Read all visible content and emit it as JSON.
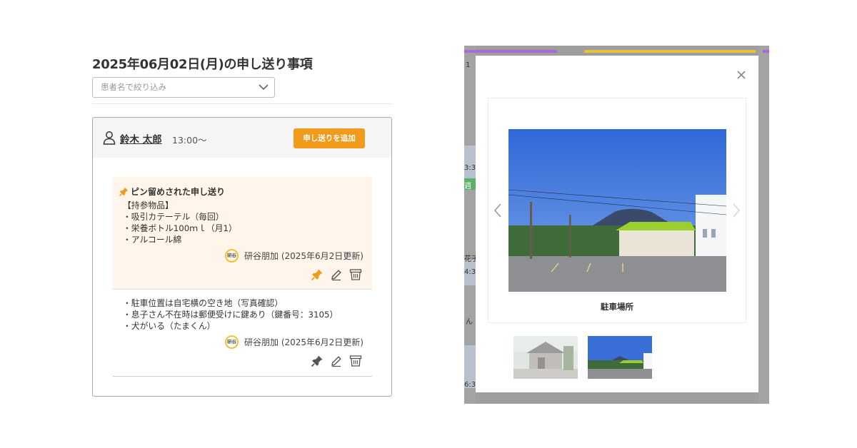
{
  "page_title": "2025年06月02日(月)の申し送り事項",
  "filter": {
    "placeholder": "患者名で絞り込み"
  },
  "patient": {
    "name": "鈴木 太郎",
    "time": "13:00〜"
  },
  "add_button": "申し送りを追加",
  "pinned_note": {
    "heading": "ピン留めされた申し送り",
    "lines": [
      "【持参物品】",
      "・吸引カテーテル（毎回）",
      "・栄養ボトル100ｍｌ（月1）",
      "・アルコール綿"
    ],
    "author_badge": "研谷",
    "author": "研谷朋加 (2025年6月2日更新)"
  },
  "note2": {
    "lines": [
      "・駐車位置は自宅横の空き地（写真確認）",
      "・息子さん不在時は郵便受けに鍵あり（鍵番号：3105）",
      "・犬がいる（たまくん）"
    ],
    "author_badge": "研谷",
    "author": "研谷朋加 (2025年6月2日更新)"
  },
  "modal": {
    "caption": "駐車場所"
  },
  "bg_fragments": [
    "1",
    "3:3",
    "週",
    "花子",
    "4:3",
    "ん",
    "6:3"
  ],
  "colors": {
    "accent": "#f29a1a",
    "pinned_bg": "#fff5ea",
    "badge_ring": "#f2c230",
    "bar_purple": "#a86ad8",
    "bar_yellow": "#e8c23a"
  },
  "icons": [
    "person-icon",
    "chevron-down-icon",
    "pin-icon",
    "edit-icon",
    "trash-icon",
    "close-icon",
    "chevron-left-icon",
    "chevron-right-icon"
  ]
}
